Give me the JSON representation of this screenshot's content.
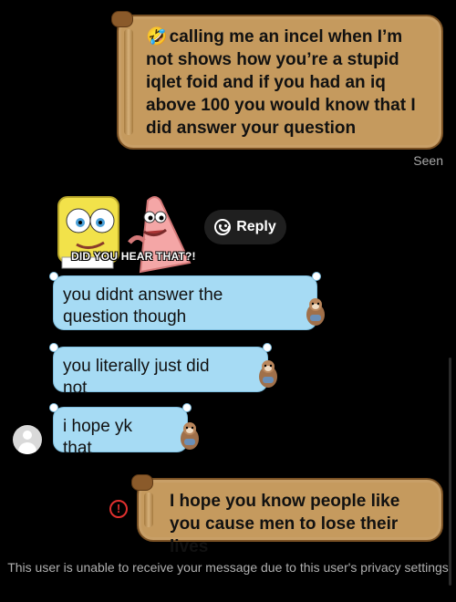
{
  "messages": {
    "m1": {
      "emoji": "🤣",
      "text": "calling me an incel when I’m not shows how you’re a stupid iqlet foid and if you had an iq above 100 you would know that I did answer your question"
    },
    "m2": {
      "text": "you didnt answer the question though"
    },
    "m3": {
      "text": "you literally just did not"
    },
    "m4": {
      "text": "i hope yk that"
    },
    "m5": {
      "text": "I hope you know people like you cause men to lose their lives"
    }
  },
  "status": {
    "seen": "Seen"
  },
  "sticker": {
    "caption": "DID YOU HEAR THAT?!"
  },
  "reply": {
    "label": "Reply",
    "icon": "smiley-icon"
  },
  "error": {
    "symbol": "!"
  },
  "footer": {
    "privacy_notice": "This user is unable to receive your message due to this user's privacy settings"
  },
  "colors": {
    "background": "#000000",
    "scroll_bubble": "#c59a5e",
    "incoming_bubble": "#a6dbf4",
    "error": "#e0302e"
  }
}
